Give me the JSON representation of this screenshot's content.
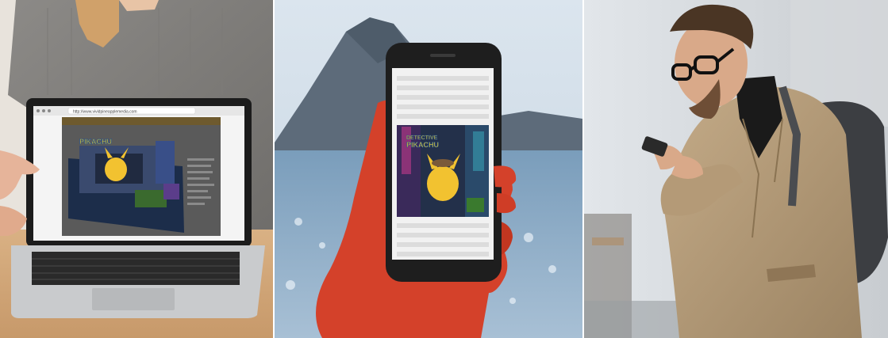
{
  "panels": [
    {
      "name": "laptop-photo"
    },
    {
      "name": "phone-in-hand-photo"
    },
    {
      "name": "man-with-phone-photo"
    }
  ],
  "laptop": {
    "url": "http://www.vividpineapplemedia.com",
    "logo_text": "PIKACHU"
  },
  "phone": {
    "logo_line1": "DETECTIVE",
    "logo_line2": "PIKACHU"
  },
  "colors": {
    "sky": "#cfdbe6",
    "sea": "#6f95b3",
    "mountain": "#5b6a78",
    "hand": "#d4412a",
    "coat": "#b49a77",
    "pikachu": "#f2c230"
  }
}
